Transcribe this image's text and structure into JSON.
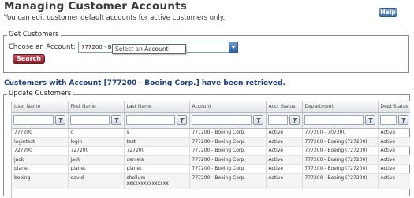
{
  "header": {
    "title": "Managing Customer Accounts",
    "help_label": "Help",
    "subtitle": "You can edit customer default accounts for active customers only."
  },
  "get_customers": {
    "legend": "Get Customers",
    "choose_label": "Choose an Account:",
    "account_value": "777200 - Boeing Corp.",
    "tooltip": "Select an Account",
    "search_label": "Search"
  },
  "status_message": "Customers with Account [777200 - Boeing Corp.] have been retrieved.",
  "update_customers": {
    "legend": "Update Customers",
    "columns": [
      "User Name",
      "First Name",
      "Last Name",
      "Account",
      "Acct Status",
      "Department",
      "Dept Status"
    ],
    "rows": [
      [
        "777200",
        "d",
        "s",
        "777200 - Boeing Corp.",
        "Active",
        "777200 - 707200",
        "Active"
      ],
      [
        "logintest",
        "login",
        "test",
        "777200 - Boeing Corp.",
        "Active",
        "777200 - Boeing (727200)",
        "Active"
      ],
      [
        "727200",
        "727200",
        "727200",
        "777200 - Boeing Corp.",
        "Active",
        "777200 - Boeing (727200)",
        "Active"
      ],
      [
        "jack",
        "jack",
        "daniels",
        "777200 - Boeing Corp.",
        "Active",
        "777200 - Boeing (727200)",
        "Active"
      ],
      [
        "planet",
        "planet",
        "planet",
        "777200 - Boeing Corp.",
        "Active",
        "777200 - Boeing (727200)",
        "Active"
      ],
      [
        "boeing",
        "david",
        "shellum\nxxxxxxxxxxxxxxx",
        "777200 - Boeing Corp.",
        "Active",
        "777200 - Boeing (727200)",
        "Active"
      ]
    ]
  }
}
